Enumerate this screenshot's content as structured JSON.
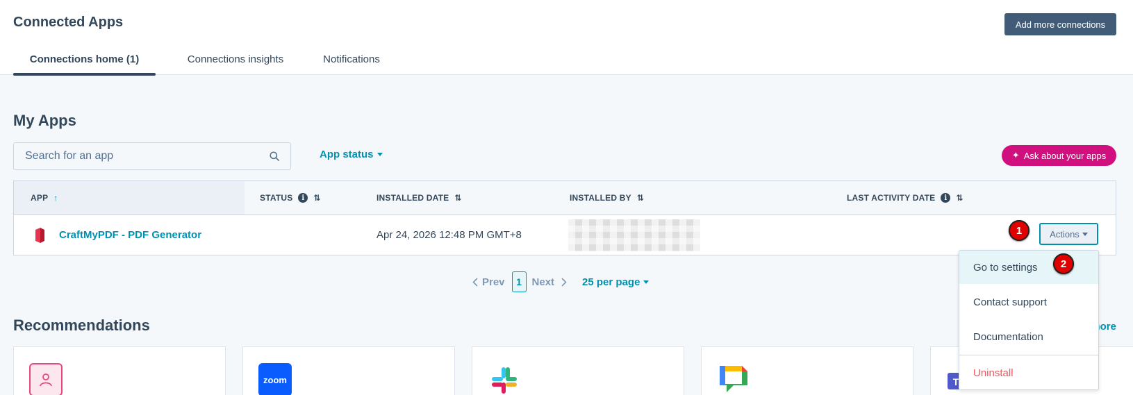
{
  "header": {
    "title": "Connected Apps",
    "add_button": "Add more connections",
    "tabs": [
      {
        "label": "Connections home (1)",
        "active": true
      },
      {
        "label": "Connections insights",
        "active": false
      },
      {
        "label": "Notifications",
        "active": false
      }
    ]
  },
  "my_apps": {
    "title": "My Apps",
    "search": {
      "placeholder": "Search for an app",
      "value": ""
    },
    "status_filter": "App status",
    "ask_button": "Ask about your apps",
    "columns": [
      "APP",
      "STATUS",
      "INSTALLED DATE",
      "INSTALLED BY",
      "LAST ACTIVITY DATE"
    ],
    "rows": [
      {
        "app": "CraftMyPDF - PDF Generator",
        "status": "",
        "installed_date": "Apr 24, 2026 12:48 PM GMT+8",
        "installed_by": "",
        "last_activity": ""
      }
    ],
    "actions_label": "Actions",
    "pagination": {
      "prev": "Prev",
      "page": "1",
      "next": "Next",
      "per_page": "25 per page"
    }
  },
  "actions_menu": {
    "items": [
      "Go to settings",
      "Contact support",
      "Documentation"
    ],
    "danger_item": "Uninstall"
  },
  "annotations": {
    "badge_1": "1",
    "badge_2": "2"
  },
  "recommendations": {
    "title": "Recommendations",
    "more_link": "See more",
    "cards": [
      {
        "logo": "person-app-icon"
      },
      {
        "logo": "zoom-icon",
        "logo_text": "zoom"
      },
      {
        "logo": "slack-icon"
      },
      {
        "logo": "google-chat-icon"
      },
      {
        "logo": "teams-icon"
      }
    ]
  },
  "colors": {
    "primary_text": "#33475b",
    "link": "#0091ae",
    "dark_button": "#425b76",
    "pink_button": "#d0107e",
    "danger": "#f2545b",
    "badge_red": "#e00000"
  }
}
